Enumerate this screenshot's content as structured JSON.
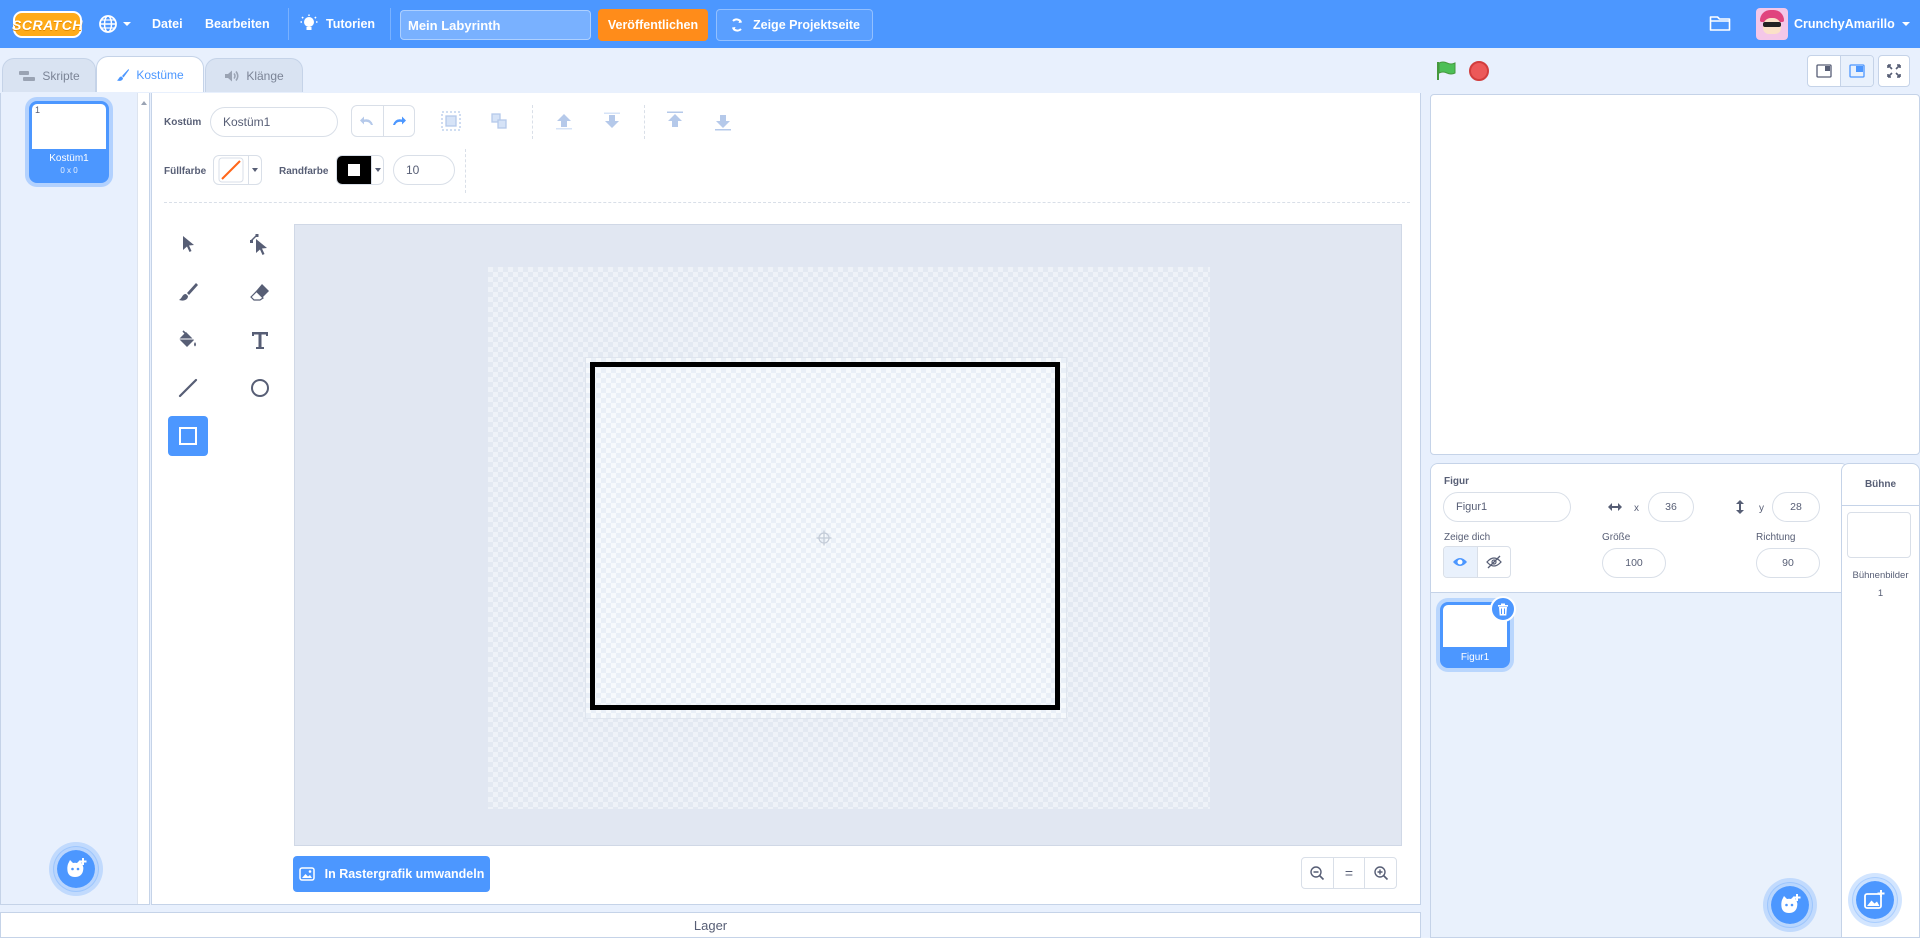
{
  "menubar": {
    "logo": "SCRATCH",
    "file": "Datei",
    "edit": "Bearbeiten",
    "tutorials": "Tutorien",
    "project_title": "Mein Labyrinth",
    "share": "Veröffentlichen",
    "see_project_page": "Zeige Projektseite",
    "username": "CrunchyAmarillo"
  },
  "tabs": {
    "code": "Skripte",
    "costumes": "Kostüme",
    "sounds": "Klänge"
  },
  "costume_list": {
    "items": [
      {
        "number": "1",
        "name": "Kostüm1",
        "size": "0 x 0"
      }
    ]
  },
  "paint": {
    "costume_label": "Kostüm",
    "costume_name": "Kostüm1",
    "fill_label": "Füllfarbe",
    "outline_label": "Randfarbe",
    "outline_width": "10",
    "convert_button": "In Rastergrafik umwandeln",
    "zoom_reset": "="
  },
  "backpack": {
    "label": "Lager"
  },
  "sprite_info": {
    "sprite_label": "Figur",
    "sprite_name": "Figur1",
    "x_label": "x",
    "x_value": "36",
    "y_label": "y",
    "y_value": "28",
    "show_label": "Zeige dich",
    "size_label": "Größe",
    "size_value": "100",
    "direction_label": "Richtung",
    "direction_value": "90"
  },
  "sprites": [
    {
      "name": "Figur1"
    }
  ],
  "stage_pane": {
    "title": "Bühne",
    "backdrops_label": "Bühnenbilder",
    "backdrops_count": "1"
  },
  "colors": {
    "brand_blue": "#4c97ff",
    "share_orange": "#ff8c1a",
    "green_flag": "#4cbf56",
    "stop_red": "#ec5959"
  }
}
